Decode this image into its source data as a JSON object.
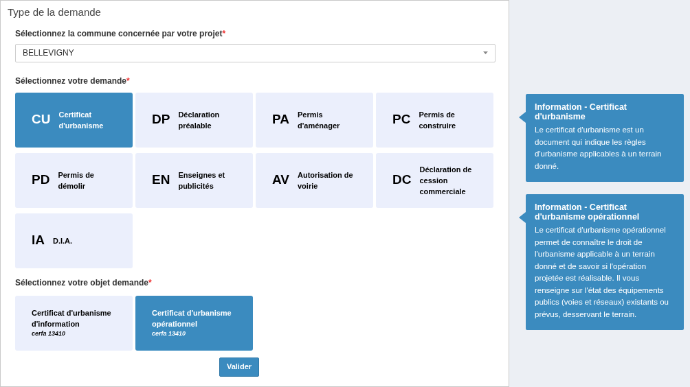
{
  "title": "Type de la demande",
  "commune": {
    "label": "Sélectionnez la commune concernée par votre projet",
    "required_mark": "*",
    "value": "BELLEVIGNY"
  },
  "demande": {
    "label": "Sélectionnez votre demande",
    "required_mark": "*",
    "options": [
      {
        "code": "CU",
        "label": "Certificat d'urbanisme",
        "selected": true
      },
      {
        "code": "DP",
        "label": "Déclaration préalable",
        "selected": false
      },
      {
        "code": "PA",
        "label": "Permis d'aménager",
        "selected": false
      },
      {
        "code": "PC",
        "label": "Permis de construire",
        "selected": false
      },
      {
        "code": "PD",
        "label": "Permis de démolir",
        "selected": false
      },
      {
        "code": "EN",
        "label": "Enseignes et publicités",
        "selected": false
      },
      {
        "code": "AV",
        "label": "Autorisation de voirie",
        "selected": false
      },
      {
        "code": "DC",
        "label": "Déclaration de cession commerciale",
        "selected": false
      },
      {
        "code": "IA",
        "label": "D.I.A.",
        "selected": false
      }
    ]
  },
  "objet": {
    "label": "Sélectionnez votre objet demande",
    "required_mark": "*",
    "options": [
      {
        "label": "Certificat d'urbanisme d'information",
        "form": "cerfa 13410",
        "selected": false
      },
      {
        "label": "Certificat d'urbanisme opérationnel",
        "form": "cerfa 13410",
        "selected": true
      }
    ]
  },
  "submit": "Valider",
  "info_panels": [
    {
      "title": "Information - Certificat d'urbanisme",
      "text": "Le certificat d'urbanisme est un document qui indique les règles d'urbanisme applicables à un terrain donné."
    },
    {
      "title": "Information - Certificat d'urbanisme opérationnel",
      "text": "Le certificat d'urbanisme opérationnel permet de connaître le droit de l'urbanisme applicable à un terrain donné et de savoir si l'opération projetée est réalisable. Il vous renseigne sur l'état des équipements publics (voies et réseaux) existants ou prévus, desservant le terrain."
    }
  ]
}
